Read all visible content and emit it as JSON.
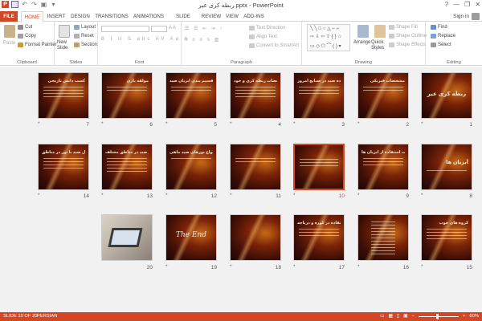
{
  "window": {
    "title": "ربطه کری عیر.pptx - PowerPoint",
    "help": "?",
    "minimize": "—",
    "restore": "❐",
    "close": "✕"
  },
  "tabs": [
    "FILE",
    "HOME",
    "INSERT",
    "DESIGN",
    "TRANSITIONS",
    "ANIMATIONS",
    "SLIDE SHOW",
    "REVIEW",
    "VIEW",
    "ADD-INS"
  ],
  "active_tab": "HOME",
  "account": {
    "signin": "Sign in"
  },
  "ribbon": {
    "clipboard": {
      "label": "Clipboard",
      "paste": "Paste",
      "cut": "Cut",
      "copy": "Copy",
      "format_painter": "Format Painter"
    },
    "slides": {
      "label": "Slides",
      "new_slide": "New Slide",
      "layout": "Layout",
      "reset": "Reset",
      "section": "Section"
    },
    "font": {
      "label": "Font"
    },
    "paragraph": {
      "label": "Paragraph",
      "text_direction": "Text Direction",
      "align_text": "Align Text",
      "convert_smartart": "Convert to SmartArt"
    },
    "drawing": {
      "label": "Drawing",
      "arrange": "Arrange",
      "quick_styles": "Quick Styles",
      "shape_fill": "Shape Fill",
      "shape_outline": "Shape Outline",
      "shape_effects": "Shape Effects"
    },
    "editing": {
      "label": "Editing",
      "find": "Find",
      "replace": "Replace",
      "select": "Select"
    }
  },
  "slides": [
    {
      "n": "7",
      "title": "کسب دانش تاریخی"
    },
    {
      "n": "6",
      "title": "مولفه بازی"
    },
    {
      "n": "5",
      "title": "تقسیم بندی آبزیان صید"
    },
    {
      "n": "4",
      "title": "مشخصات ربطه کری و خود"
    },
    {
      "n": "3",
      "title": "دلایل استفاده صید در صنایع امروز"
    },
    {
      "n": "2",
      "title": "مشخصات فیزیکی"
    },
    {
      "n": "1",
      "title": "ربطه کری عیر"
    },
    {
      "n": "14",
      "title": "مراحل صید با تور در مناطق"
    },
    {
      "n": "13",
      "title": "جدول آمار صید در مناطق مختلف"
    },
    {
      "n": "12",
      "title": "انواع تورهای صید ماهی"
    },
    {
      "n": "11",
      "title": ""
    },
    {
      "n": "10",
      "title": ""
    },
    {
      "n": "9",
      "title": "علت استفاده از آبزیان ها"
    },
    {
      "n": "8",
      "title": "آبزیان ها"
    },
    {
      "n": "20",
      "title": ""
    },
    {
      "n": "19",
      "title": "The End"
    },
    {
      "n": "18",
      "title": ""
    },
    {
      "n": "17",
      "title": "موارد مورد استفاده در کوره و دریاچه"
    },
    {
      "n": "16",
      "title": ""
    },
    {
      "n": "15",
      "title": "کروه های خوب"
    }
  ],
  "status": {
    "slide_info": "SLIDE 10 OF 20",
    "language": "PERSIAN",
    "zoom": "60%"
  }
}
